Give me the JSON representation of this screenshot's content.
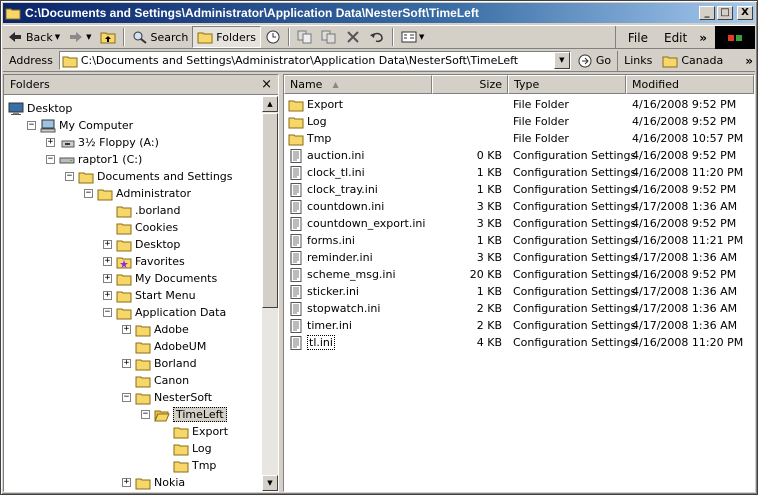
{
  "window": {
    "title": "C:\\Documents and Settings\\Administrator\\Application Data\\NesterSoft\\TimeLeft",
    "minimize": "_",
    "maximize": "□",
    "close": "X"
  },
  "toolbar": {
    "back_label": "Back",
    "search_label": "Search",
    "folders_label": "Folders"
  },
  "menu": {
    "file": "File",
    "edit": "Edit",
    "more": "»"
  },
  "address": {
    "label": "Address",
    "value": "C:\\Documents and Settings\\Administrator\\Application Data\\NesterSoft\\TimeLeft",
    "go_label": "Go",
    "links_label": "Links",
    "link_canada": "Canada",
    "more": "»"
  },
  "folders_pane": {
    "title": "Folders",
    "close": "×",
    "tree": [
      {
        "label": "Desktop",
        "depth": 0,
        "exp": "",
        "icon": "desktop-icon"
      },
      {
        "label": "My Computer",
        "depth": 1,
        "exp": "−",
        "icon": "computer-icon"
      },
      {
        "label": "3½ Floppy (A:)",
        "depth": 2,
        "exp": "+",
        "icon": "floppy-icon"
      },
      {
        "label": "raptor1 (C:)",
        "depth": 2,
        "exp": "−",
        "icon": "drive-icon"
      },
      {
        "label": "Documents and Settings",
        "depth": 3,
        "exp": "−",
        "icon": "folder-icon"
      },
      {
        "label": "Administrator",
        "depth": 4,
        "exp": "−",
        "icon": "folder-icon"
      },
      {
        "label": ".borland",
        "depth": 5,
        "exp": "",
        "icon": "folder-icon"
      },
      {
        "label": "Cookies",
        "depth": 5,
        "exp": "",
        "icon": "folder-icon"
      },
      {
        "label": "Desktop",
        "depth": 5,
        "exp": "+",
        "icon": "folder-icon"
      },
      {
        "label": "Favorites",
        "depth": 5,
        "exp": "+",
        "icon": "favorites-icon"
      },
      {
        "label": "My Documents",
        "depth": 5,
        "exp": "+",
        "icon": "folder-icon"
      },
      {
        "label": "Start Menu",
        "depth": 5,
        "exp": "+",
        "icon": "folder-icon"
      },
      {
        "label": "Application Data",
        "depth": 5,
        "exp": "−",
        "icon": "folder-icon"
      },
      {
        "label": "Adobe",
        "depth": 6,
        "exp": "+",
        "icon": "folder-icon"
      },
      {
        "label": "AdobeUM",
        "depth": 6,
        "exp": "",
        "icon": "folder-icon"
      },
      {
        "label": "Borland",
        "depth": 6,
        "exp": "+",
        "icon": "folder-icon"
      },
      {
        "label": "Canon",
        "depth": 6,
        "exp": "",
        "icon": "folder-icon"
      },
      {
        "label": "NesterSoft",
        "depth": 6,
        "exp": "−",
        "icon": "folder-icon"
      },
      {
        "label": "TimeLeft",
        "depth": 7,
        "exp": "−",
        "icon": "open-folder-icon",
        "selected": true
      },
      {
        "label": "Export",
        "depth": 8,
        "exp": "",
        "icon": "folder-icon"
      },
      {
        "label": "Log",
        "depth": 8,
        "exp": "",
        "icon": "folder-icon"
      },
      {
        "label": "Tmp",
        "depth": 8,
        "exp": "",
        "icon": "folder-icon"
      },
      {
        "label": "Nokia",
        "depth": 6,
        "exp": "+",
        "icon": "folder-icon"
      }
    ]
  },
  "file_list": {
    "columns": [
      "Name",
      "Size",
      "Type",
      "Modified"
    ],
    "rows": [
      {
        "name": "Export",
        "size": "",
        "type": "File Folder",
        "modified": "4/16/2008 9:52 PM",
        "icon": "folder-icon"
      },
      {
        "name": "Log",
        "size": "",
        "type": "File Folder",
        "modified": "4/16/2008 9:52 PM",
        "icon": "folder-icon"
      },
      {
        "name": "Tmp",
        "size": "",
        "type": "File Folder",
        "modified": "4/16/2008 10:57 PM",
        "icon": "folder-icon"
      },
      {
        "name": "auction.ini",
        "size": "0 KB",
        "type": "Configuration Settings",
        "modified": "4/16/2008 9:52 PM",
        "icon": "ini-file-icon"
      },
      {
        "name": "clock_tl.ini",
        "size": "1 KB",
        "type": "Configuration Settings",
        "modified": "4/16/2008 11:20 PM",
        "icon": "ini-file-icon"
      },
      {
        "name": "clock_tray.ini",
        "size": "1 KB",
        "type": "Configuration Settings",
        "modified": "4/16/2008 9:52 PM",
        "icon": "ini-file-icon"
      },
      {
        "name": "countdown.ini",
        "size": "3 KB",
        "type": "Configuration Settings",
        "modified": "4/17/2008 1:36 AM",
        "icon": "ini-file-icon"
      },
      {
        "name": "countdown_export.ini",
        "size": "3 KB",
        "type": "Configuration Settings",
        "modified": "4/16/2008 9:52 PM",
        "icon": "ini-file-icon"
      },
      {
        "name": "forms.ini",
        "size": "1 KB",
        "type": "Configuration Settings",
        "modified": "4/16/2008 11:21 PM",
        "icon": "ini-file-icon"
      },
      {
        "name": "reminder.ini",
        "size": "3 KB",
        "type": "Configuration Settings",
        "modified": "4/17/2008 1:36 AM",
        "icon": "ini-file-icon"
      },
      {
        "name": "scheme_msg.ini",
        "size": "20 KB",
        "type": "Configuration Settings",
        "modified": "4/16/2008 9:52 PM",
        "icon": "ini-file-icon"
      },
      {
        "name": "sticker.ini",
        "size": "1 KB",
        "type": "Configuration Settings",
        "modified": "4/17/2008 1:36 AM",
        "icon": "ini-file-icon"
      },
      {
        "name": "stopwatch.ini",
        "size": "2 KB",
        "type": "Configuration Settings",
        "modified": "4/17/2008 1:36 AM",
        "icon": "ini-file-icon"
      },
      {
        "name": "timer.ini",
        "size": "2 KB",
        "type": "Configuration Settings",
        "modified": "4/17/2008 1:36 AM",
        "icon": "ini-file-icon"
      },
      {
        "name": "tl.ini",
        "size": "4 KB",
        "type": "Configuration Settings",
        "modified": "4/16/2008 11:20 PM",
        "icon": "ini-file-icon",
        "focused": true
      }
    ]
  }
}
